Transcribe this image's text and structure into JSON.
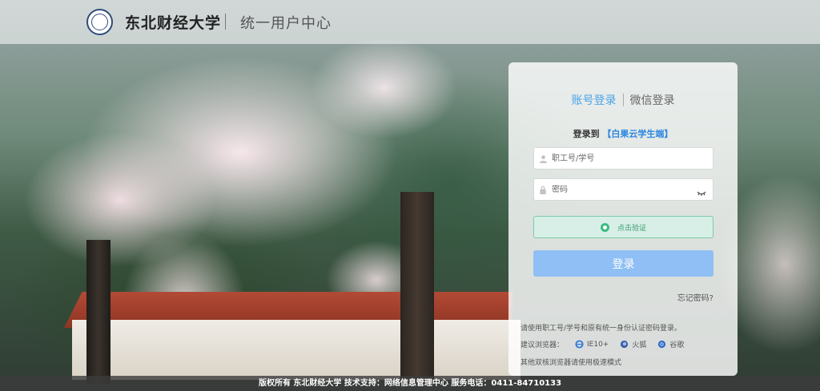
{
  "header": {
    "school_name": "东北财经大学",
    "center_name": "统一用户中心"
  },
  "login": {
    "tabs": [
      {
        "label": "账号登录",
        "active": true
      },
      {
        "label": "微信登录",
        "active": false
      }
    ],
    "login_to_prefix": "登录到",
    "login_to_app": "【白果云学生端】",
    "username_placeholder": "职工号/学号",
    "password_placeholder": "密码",
    "verify_label": "点击验证",
    "login_button": "登录",
    "forgot_link": "忘记密码?",
    "tip": "请使用职工号/学号和原有统一身份认证密码登录。",
    "browsers_label": "建议浏览器：",
    "browsers": [
      {
        "name": "IE10+",
        "icon": "ie-icon",
        "color": "#2f7ad8"
      },
      {
        "name": "火狐",
        "icon": "firefox-icon",
        "color": "#3d5fa8"
      },
      {
        "name": "谷歌",
        "icon": "chrome-icon",
        "color": "#2e6cc7"
      }
    ],
    "other_browsers": "其他双核浏览器请使用极速模式"
  },
  "footer": {
    "text": "版权所有 东北财经大学 技术支持：网络信息管理中心 服务电话：0411-84710133"
  },
  "colors": {
    "accent": "#4aa3e8",
    "verify_bg": "#d7efe6",
    "verify_border": "#7ccaa9",
    "login_button": "#8fbff5"
  }
}
